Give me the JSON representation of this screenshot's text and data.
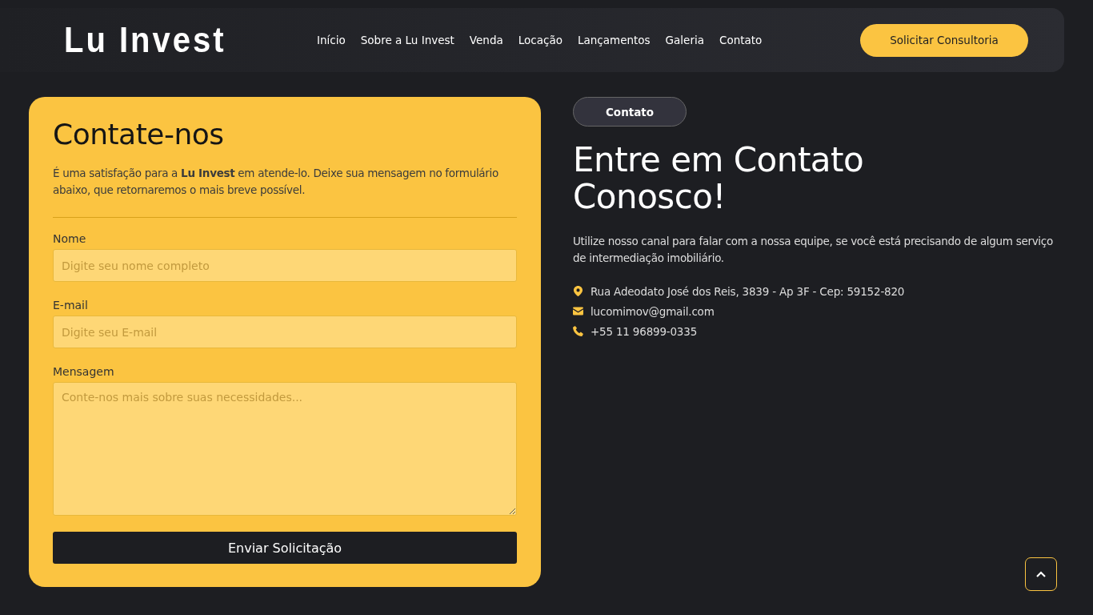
{
  "header": {
    "logo": "Lu Invest",
    "nav": [
      {
        "label": "Início"
      },
      {
        "label": "Sobre a Lu Invest"
      },
      {
        "label": "Venda"
      },
      {
        "label": "Locação"
      },
      {
        "label": "Lançamentos"
      },
      {
        "label": "Galeria"
      },
      {
        "label": "Contato"
      }
    ],
    "cta": "Solicitar Consultoria"
  },
  "form": {
    "title": "Contate-nos",
    "intro": "É uma satisfação para a **Lu Invest** em atende-lo. Deixe sua mensagem no formulário abaixo, que retornaremos o mais breve possível.",
    "fields": [
      {
        "kind": "input",
        "label": "Nome",
        "placeholder": "Digite seu nome completo"
      },
      {
        "kind": "input",
        "label": "E-mail",
        "placeholder": "Digite seu E-mail"
      },
      {
        "kind": "textarea",
        "label": "Mensagem",
        "placeholder": "Conte-nos mais sobre suas necessidades..."
      }
    ],
    "submit": "Enviar Solicitação"
  },
  "contact": {
    "badge": "Contato",
    "title": "Entre em Contato Conosco!",
    "text": "Utilize nosso canal para falar com a nossa equipe, se você está precisando de algum serviço de intermediação imobiliário.",
    "items": [
      {
        "kind": "address",
        "text": "Rua Adeodato José dos Reis, 3839 - Ap 3F - Cep: 59152-820"
      },
      {
        "kind": "email",
        "text": "lucomimov@gmail.com"
      },
      {
        "kind": "phone",
        "text": "+55 11 96899-0335"
      }
    ]
  }
}
